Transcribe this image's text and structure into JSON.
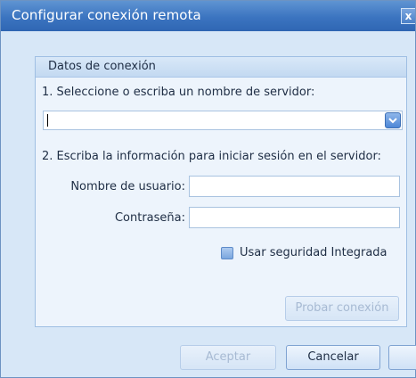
{
  "window": {
    "title": "Configurar conexión remota",
    "close_label": "x"
  },
  "group": {
    "title": "Datos de conexión"
  },
  "server": {
    "step_label": "1. Seleccione o escriba un nombre de servidor:",
    "value": ""
  },
  "login": {
    "step_label": "2. Escriba la información para iniciar sesión en el servidor:",
    "username_label": "Nombre de usuario:",
    "username_value": "",
    "password_label": "Contraseña:",
    "password_value": "",
    "integrated_security_label": "Usar seguridad Integrada",
    "integrated_security_checked": false
  },
  "buttons": {
    "test_connection": "Probar conexión",
    "accept": "Aceptar",
    "cancel": "Cancelar"
  },
  "icons": {
    "combo": "chevron-down-icon",
    "close": "close-icon"
  }
}
